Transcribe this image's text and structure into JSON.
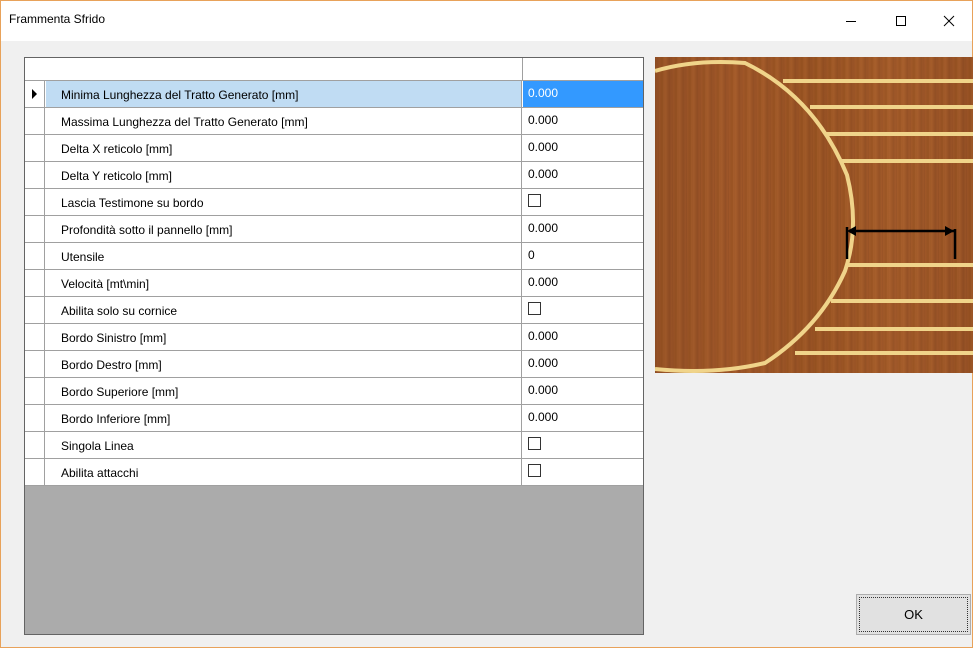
{
  "window": {
    "title": "Frammenta Sfrido"
  },
  "grid": {
    "rows": [
      {
        "label": "Minima Lunghezza del Tratto Generato [mm]",
        "value": "0.000",
        "type": "text",
        "selected": true
      },
      {
        "label": "Massima Lunghezza del Tratto Generato [mm]",
        "value": "0.000",
        "type": "text"
      },
      {
        "label": "Delta X reticolo [mm]",
        "value": "0.000",
        "type": "text"
      },
      {
        "label": "Delta Y reticolo [mm]",
        "value": "0.000",
        "type": "text"
      },
      {
        "label": "Lascia Testimone su bordo",
        "value": "",
        "type": "checkbox",
        "checked": false
      },
      {
        "label": "Profondità sotto il pannello [mm]",
        "value": "0.000",
        "type": "text"
      },
      {
        "label": "Utensile",
        "value": "0",
        "type": "text"
      },
      {
        "label": "Velocità [mt\\min]",
        "value": "0.000",
        "type": "text"
      },
      {
        "label": "Abilita solo su cornice",
        "value": "",
        "type": "checkbox",
        "checked": false
      },
      {
        "label": "Bordo Sinistro [mm]",
        "value": "0.000",
        "type": "text"
      },
      {
        "label": "Bordo Destro [mm]",
        "value": "0.000",
        "type": "text"
      },
      {
        "label": "Bordo Superiore [mm]",
        "value": "0.000",
        "type": "text"
      },
      {
        "label": "Bordo Inferiore [mm]",
        "value": "0.000",
        "type": "text"
      },
      {
        "label": "Singola Linea",
        "value": "",
        "type": "checkbox",
        "checked": false
      },
      {
        "label": "Abilita attacchi",
        "value": "",
        "type": "checkbox",
        "checked": false
      }
    ]
  },
  "buttons": {
    "ok": "OK"
  },
  "colors": {
    "selection": "#3399ff",
    "selection_light": "#c0dcf3",
    "wood": "#9c5425",
    "cut_line": "#f0d48a"
  }
}
